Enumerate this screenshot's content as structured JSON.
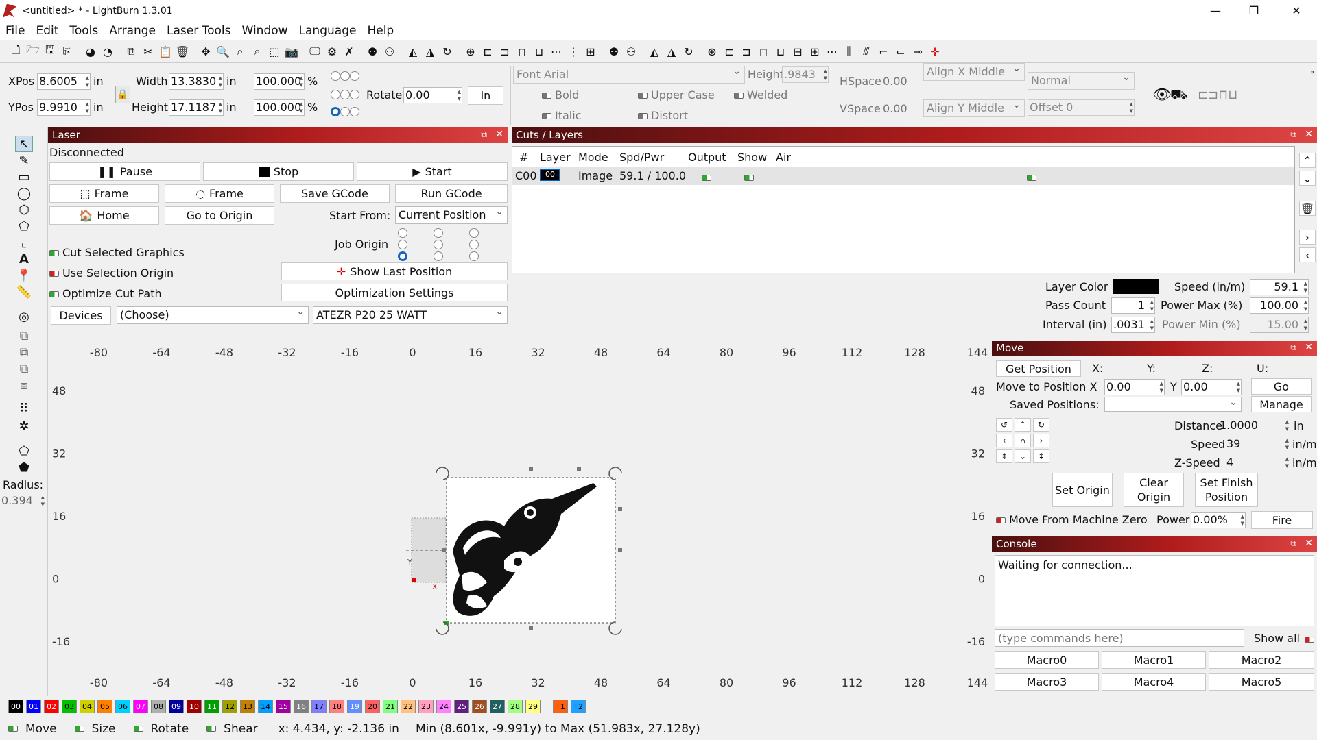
{
  "window": {
    "title": "<untitled> * - LightBurn 1.3.01",
    "min": "—",
    "restore": "❐",
    "close": "✕"
  },
  "menu": [
    "File",
    "Edit",
    "Tools",
    "Arrange",
    "Laser Tools",
    "Window",
    "Language",
    "Help"
  ],
  "props": {
    "xpos_label": "XPos",
    "xpos": "8.6005",
    "ypos_label": "YPos",
    "ypos": "9.9910",
    "unit": "in",
    "width_label": "Width",
    "width": "13.3830",
    "height_label": "Height",
    "height": "17.1187",
    "scale_w": "100.000",
    "scale_h": "100.000",
    "pct": "%",
    "rotate_label": "Rotate",
    "rotate": "0.00",
    "unit_btn": "in",
    "font_label": "Font",
    "font": "Arial",
    "font_height_label": "Height",
    "font_height": ".9843",
    "hspace_label": "HSpace",
    "hspace": "0.00",
    "vspace_label": "VSpace",
    "vspace": "0.00",
    "alignx": "Align X Middle",
    "aligny": "Align Y Middle",
    "normal": "Normal",
    "offset": "Offset 0",
    "bold": "Bold",
    "italic": "Italic",
    "upper": "Upper Case",
    "distort": "Distort",
    "welded": "Welded"
  },
  "laser": {
    "title": "Laser",
    "status": "Disconnected",
    "pause": "Pause",
    "stop": "Stop",
    "start": "Start",
    "frame1": "Frame",
    "frame2": "Frame",
    "save_gcode": "Save GCode",
    "run_gcode": "Run GCode",
    "home": "Home",
    "go_origin": "Go to Origin",
    "start_from_label": "Start From:",
    "start_from": "Current Position",
    "job_origin": "Job Origin",
    "cut_selected": "Cut Selected Graphics",
    "use_selection": "Use Selection Origin",
    "optimize": "Optimize Cut Path",
    "show_last": "Show Last Position",
    "opt_settings": "Optimization Settings",
    "devices": "Devices",
    "choose": "(Choose)",
    "device": "ATEZR P20 25 WATT"
  },
  "cuts": {
    "title": "Cuts / Layers",
    "headers": [
      "#",
      "Layer",
      "Mode",
      "Spd/Pwr",
      "Output",
      "Show",
      "Air"
    ],
    "row": {
      "num": "C00",
      "layer": "00",
      "mode": "Image",
      "spdpwr": "59.1 / 100.0"
    },
    "layer_color_label": "Layer Color",
    "pass_count_label": "Pass Count",
    "pass_count": "1",
    "interval_label": "Interval (in)",
    "interval": ".0031",
    "speed_label": "Speed (in/m)",
    "speed": "59.1",
    "pmax_label": "Power Max (%)",
    "pmax": "100.00",
    "pmin_label": "Power Min (%)",
    "pmin": "15.00",
    "layer_color_hex": "#000000"
  },
  "move": {
    "title": "Move",
    "get_pos": "Get Position",
    "x": "X:",
    "y": "Y:",
    "z": "Z:",
    "u": "U:",
    "move_to": "Move to Position X",
    "mx": "0.00",
    "y_lbl": "Y",
    "my": "0.00",
    "go": "Go",
    "saved": "Saved Positions:",
    "manage": "Manage",
    "distance_label": "Distance",
    "distance": "1.0000",
    "dist_unit": "in",
    "speed_label": "Speed",
    "speed": "39",
    "speed_unit": "in/m",
    "zspeed_label": "Z-Speed",
    "zspeed": "4",
    "zspeed_unit": "in/m",
    "set_origin": "Set Origin",
    "clear_origin": "Clear Origin",
    "set_finish": "Set Finish Position",
    "from_zero": "Move From Machine Zero",
    "power_label": "Power",
    "power": "0.00%",
    "fire": "Fire"
  },
  "console": {
    "title": "Console",
    "message": "Waiting for connection...",
    "placeholder": "(type commands here)",
    "show_all": "Show all",
    "macros": [
      "Macro0",
      "Macro1",
      "Macro2",
      "Macro3",
      "Macro4",
      "Macro5"
    ]
  },
  "left": {
    "radius_label": "Radius:",
    "radius": "0.394"
  },
  "ruler": {
    "x": [
      "-80",
      "-64",
      "-48",
      "-32",
      "-16",
      "0",
      "16",
      "32",
      "48",
      "64",
      "80",
      "96",
      "112",
      "128",
      "144"
    ],
    "y": [
      "48",
      "32",
      "16",
      "0",
      "-16"
    ]
  },
  "canvas": {
    "axis_x": "X",
    "axis_y": "Y"
  },
  "palette": [
    {
      "l": "00",
      "c": "#000000",
      "t": "#fff"
    },
    {
      "l": "01",
      "c": "#0000ff",
      "t": "#fff"
    },
    {
      "l": "02",
      "c": "#ff0000",
      "t": "#fff"
    },
    {
      "l": "03",
      "c": "#00c000",
      "t": "#000"
    },
    {
      "l": "04",
      "c": "#d0d000",
      "t": "#000"
    },
    {
      "l": "05",
      "c": "#ff8000",
      "t": "#000"
    },
    {
      "l": "06",
      "c": "#00d0ff",
      "t": "#000"
    },
    {
      "l": "07",
      "c": "#ff00ff",
      "t": "#fff"
    },
    {
      "l": "08",
      "c": "#b0b0b0",
      "t": "#000"
    },
    {
      "l": "09",
      "c": "#0000a0",
      "t": "#fff"
    },
    {
      "l": "10",
      "c": "#a00000",
      "t": "#fff"
    },
    {
      "l": "11",
      "c": "#00a000",
      "t": "#fff"
    },
    {
      "l": "12",
      "c": "#a0a000",
      "t": "#000"
    },
    {
      "l": "13",
      "c": "#c08000",
      "t": "#000"
    },
    {
      "l": "14",
      "c": "#00a0ff",
      "t": "#000"
    },
    {
      "l": "15",
      "c": "#a000a0",
      "t": "#fff"
    },
    {
      "l": "16",
      "c": "#808080",
      "t": "#fff"
    },
    {
      "l": "17",
      "c": "#8080ff",
      "t": "#000"
    },
    {
      "l": "18",
      "c": "#ff8080",
      "t": "#000"
    },
    {
      "l": "19",
      "c": "#6090ff",
      "t": "#fff"
    },
    {
      "l": "20",
      "c": "#ff6060",
      "t": "#000"
    },
    {
      "l": "21",
      "c": "#80ff80",
      "t": "#000"
    },
    {
      "l": "22",
      "c": "#ffc080",
      "t": "#000"
    },
    {
      "l": "23",
      "c": "#ffa0c0",
      "t": "#000"
    },
    {
      "l": "24",
      "c": "#ff80ff",
      "t": "#000"
    },
    {
      "l": "25",
      "c": "#602080",
      "t": "#fff"
    },
    {
      "l": "26",
      "c": "#a05020",
      "t": "#fff"
    },
    {
      "l": "27",
      "c": "#206060",
      "t": "#fff"
    },
    {
      "l": "28",
      "c": "#a0ff80",
      "t": "#000"
    },
    {
      "l": "29",
      "c": "#ffff80",
      "t": "#000"
    },
    {
      "l": "T1",
      "c": "#ff6010",
      "t": "#000"
    },
    {
      "l": "T2",
      "c": "#20a0ff",
      "t": "#000"
    }
  ],
  "status": {
    "move": "Move",
    "size": "Size",
    "rotate": "Rotate",
    "shear": "Shear",
    "coords": "x: 4.434, y: -2.136 in",
    "bounds": "Min (8.601x, -9.991y) to Max (51.983x, 27.128y)"
  }
}
